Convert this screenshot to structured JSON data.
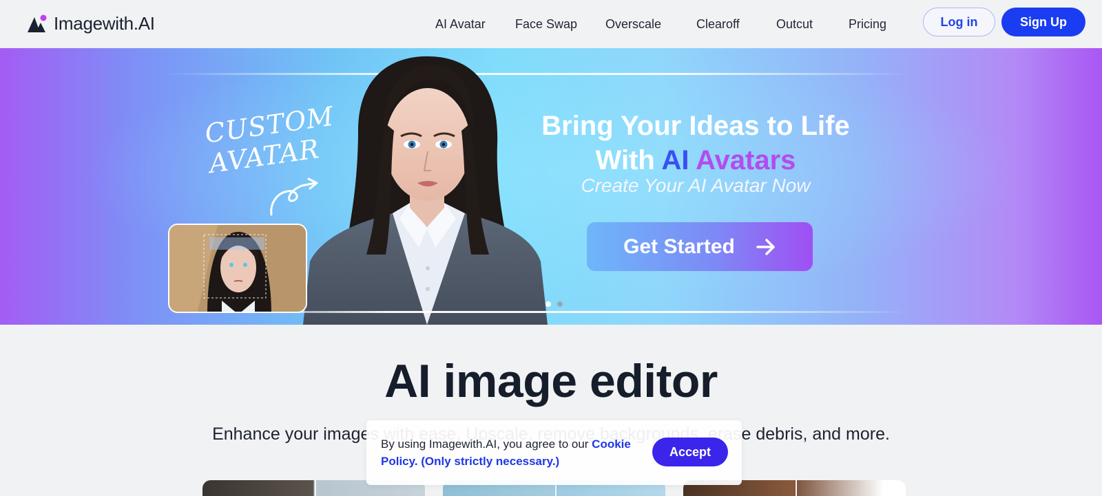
{
  "header": {
    "logo_text": "Imagewith.AI",
    "nav": [
      "AI Avatar",
      "Face Swap",
      "Overscale",
      "Clearoff",
      "Outcut",
      "Pricing"
    ],
    "login_label": "Log in",
    "signup_label": "Sign Up"
  },
  "hero": {
    "badge_text": "Custom Avatar",
    "title_line1": "Bring Your Ideas to Life",
    "title_with": "With ",
    "title_ai": "AI",
    "title_avatars": "Avatars",
    "subtitle": "Create Your AI Avatar Now",
    "cta_label": "Get Started",
    "slide_count": 2,
    "active_slide": 1
  },
  "main": {
    "title": "AI image editor",
    "subtitle": "Enhance your images with ease. Upscale, remove backgrounds, erase debris, and more."
  },
  "cookie": {
    "text": "By using Imagewith.AI, you agree to our ",
    "link_text": "Cookie Policy. (Only strictly necessary.)",
    "accept_label": "Accept"
  },
  "colors": {
    "brand_blue": "#1a3df2",
    "accept_purple": "#3b25ea",
    "link_blue": "#1d38e6"
  }
}
